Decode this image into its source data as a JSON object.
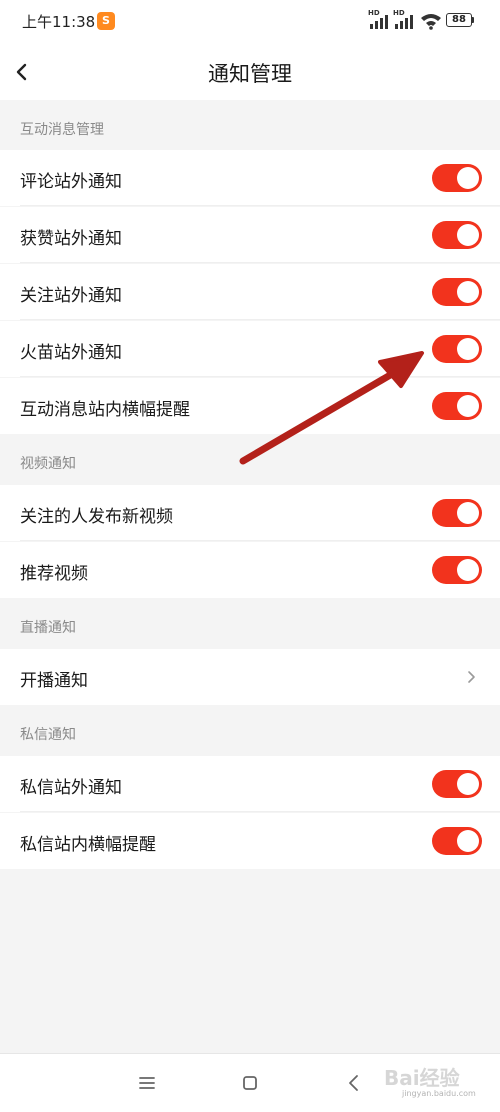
{
  "status_bar": {
    "time": "上午11:38",
    "app_icon_text": "S",
    "signal1_label": "HD",
    "signal2_label": "HD",
    "battery": "88"
  },
  "header": {
    "title": "通知管理"
  },
  "sections": [
    {
      "title": "互动消息管理",
      "items": [
        {
          "label": "评论站外通知",
          "toggle_on": true
        },
        {
          "label": "获赞站外通知",
          "toggle_on": true
        },
        {
          "label": "关注站外通知",
          "toggle_on": true
        },
        {
          "label": "火苗站外通知",
          "toggle_on": true
        },
        {
          "label": "互动消息站内横幅提醒",
          "toggle_on": true
        }
      ]
    },
    {
      "title": "视频通知",
      "items": [
        {
          "label": "关注的人发布新视频",
          "toggle_on": true
        },
        {
          "label": "推荐视频",
          "toggle_on": true
        }
      ]
    },
    {
      "title": "直播通知",
      "items": [
        {
          "label": "开播通知",
          "control": "chevron-right"
        }
      ]
    },
    {
      "title": "私信通知",
      "items": [
        {
          "label": "私信站外通知",
          "toggle_on": true
        },
        {
          "label": "私信站内横幅提醒",
          "toggle_on": true
        }
      ]
    }
  ],
  "watermark": {
    "text": "Bai经验",
    "sub": "jingyan.baidu.com"
  },
  "colors": {
    "toggle_on": "#f2331d",
    "annotation_arrow": "#b3211a",
    "background": "#f4f4f4"
  }
}
